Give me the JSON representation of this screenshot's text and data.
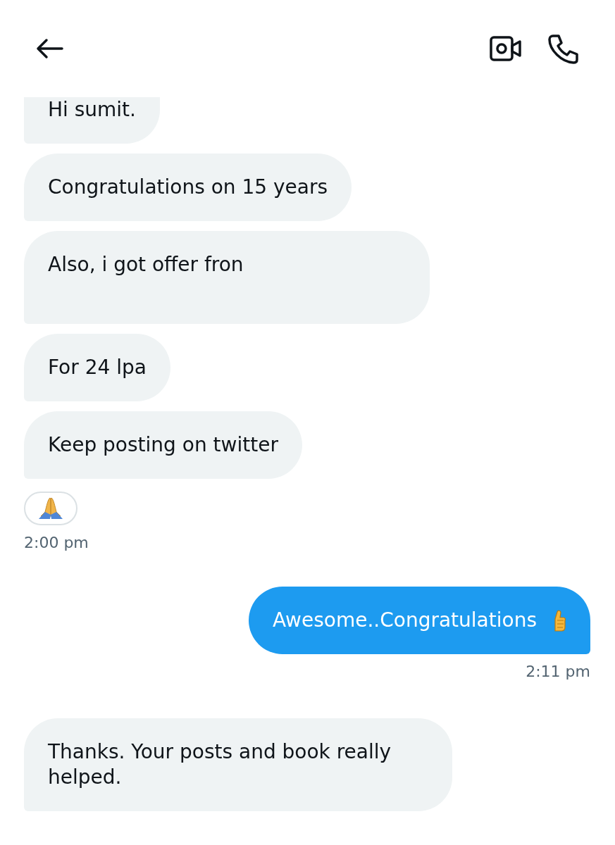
{
  "messages": [
    {
      "kind": "received",
      "text": "Hi sumit."
    },
    {
      "kind": "received",
      "text": "Congratulations on 15 years"
    },
    {
      "kind": "received",
      "text": "Also,  i got offer fron",
      "redacted": true
    },
    {
      "kind": "received",
      "text": "For 24 lpa"
    },
    {
      "kind": "received",
      "text": "Keep posting on twitter",
      "reaction": true,
      "time": "2:00 pm"
    },
    {
      "kind": "sent",
      "text": "Awesome..Congratulations",
      "trailing_emoji": true,
      "time": "2:11 pm"
    },
    {
      "kind": "received",
      "text": "Thanks. Your posts and book really helped."
    }
  ]
}
